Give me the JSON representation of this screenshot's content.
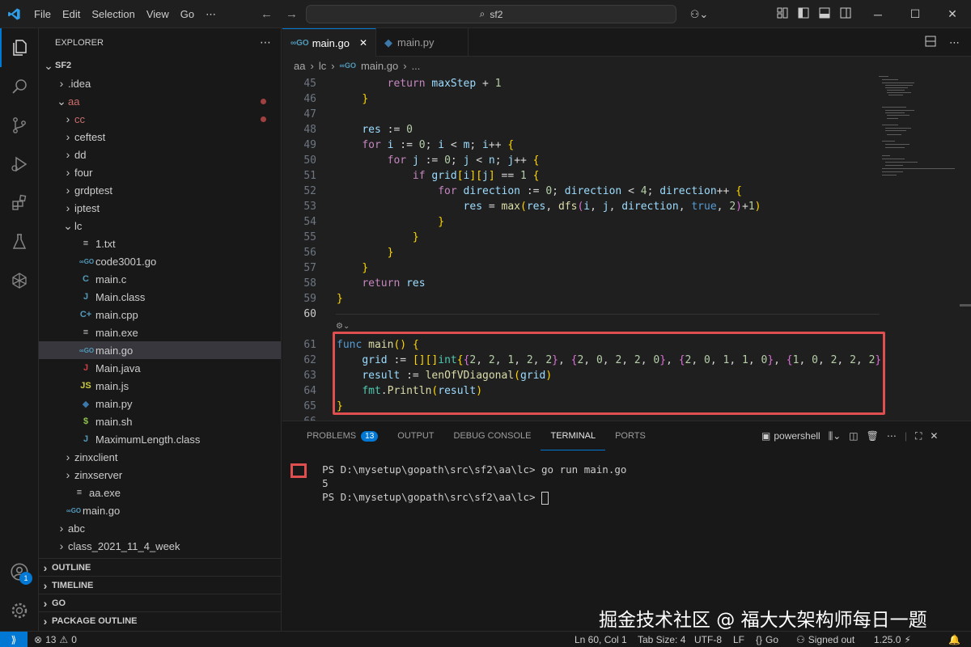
{
  "menu": [
    "File",
    "Edit",
    "Selection",
    "View",
    "Go",
    "⋯"
  ],
  "command_center": "sf2",
  "sidebar": {
    "title": "EXPLORER",
    "tree": [
      {
        "label": "SF2",
        "depth": 0,
        "type": "root",
        "open": true
      },
      {
        "label": ".idea",
        "depth": 1,
        "type": "folder",
        "open": false
      },
      {
        "label": "aa",
        "depth": 1,
        "type": "folder",
        "open": true,
        "modified": true
      },
      {
        "label": "cc",
        "depth": 2,
        "type": "folder",
        "open": false,
        "modified": true
      },
      {
        "label": "ceftest",
        "depth": 2,
        "type": "folder",
        "open": false
      },
      {
        "label": "dd",
        "depth": 2,
        "type": "folder",
        "open": false
      },
      {
        "label": "four",
        "depth": 2,
        "type": "folder",
        "open": false
      },
      {
        "label": "grdptest",
        "depth": 2,
        "type": "folder",
        "open": false
      },
      {
        "label": "iptest",
        "depth": 2,
        "type": "folder",
        "open": false
      },
      {
        "label": "lc",
        "depth": 2,
        "type": "folder",
        "open": true
      },
      {
        "label": "1.txt",
        "depth": 3,
        "type": "txt"
      },
      {
        "label": "code3001.go",
        "depth": 3,
        "type": "go"
      },
      {
        "label": "main.c",
        "depth": 3,
        "type": "c"
      },
      {
        "label": "Main.class",
        "depth": 3,
        "type": "java"
      },
      {
        "label": "main.cpp",
        "depth": 3,
        "type": "cpp"
      },
      {
        "label": "main.exe",
        "depth": 3,
        "type": "txt"
      },
      {
        "label": "main.go",
        "depth": 3,
        "type": "go",
        "selected": true
      },
      {
        "label": "Main.java",
        "depth": 3,
        "type": "javared"
      },
      {
        "label": "main.js",
        "depth": 3,
        "type": "js"
      },
      {
        "label": "main.py",
        "depth": 3,
        "type": "py"
      },
      {
        "label": "main.sh",
        "depth": 3,
        "type": "sh"
      },
      {
        "label": "MaximumLength.class",
        "depth": 3,
        "type": "java"
      },
      {
        "label": "zinxclient",
        "depth": 2,
        "type": "folder",
        "open": false
      },
      {
        "label": "zinxserver",
        "depth": 2,
        "type": "folder",
        "open": false
      },
      {
        "label": "aa.exe",
        "depth": 2,
        "type": "txt"
      },
      {
        "label": "main.go",
        "depth": 1,
        "type": "go"
      },
      {
        "label": "abc",
        "depth": 1,
        "type": "folder",
        "open": false
      },
      {
        "label": "class_2021_11_4_week",
        "depth": 1,
        "type": "folder",
        "open": false
      }
    ],
    "sections": [
      "OUTLINE",
      "TIMELINE",
      "GO",
      "PACKAGE OUTLINE"
    ]
  },
  "tabs": [
    {
      "label": "main.go",
      "active": true
    },
    {
      "label": "main.py",
      "active": false
    }
  ],
  "breadcrumb": [
    "aa",
    "lc",
    "main.go",
    "..."
  ],
  "code_lines": [
    {
      "n": "45",
      "code": "        return maxStep + 1"
    },
    {
      "n": "46",
      "code": "    }"
    },
    {
      "n": "47",
      "code": ""
    },
    {
      "n": "48",
      "code": "    res := 0"
    },
    {
      "n": "49",
      "code": "    for i := 0; i < m; i++ {"
    },
    {
      "n": "50",
      "code": "        for j := 0; j < n; j++ {"
    },
    {
      "n": "51",
      "code": "            if grid[i][j] == 1 {"
    },
    {
      "n": "52",
      "code": "                for direction := 0; direction < 4; direction++ {"
    },
    {
      "n": "53",
      "code": "                    res = max(res, dfs(i, j, direction, true, 2)+1)"
    },
    {
      "n": "54",
      "code": "                }"
    },
    {
      "n": "55",
      "code": "            }"
    },
    {
      "n": "56",
      "code": "        }"
    },
    {
      "n": "57",
      "code": "    }"
    },
    {
      "n": "58",
      "code": "    return res"
    },
    {
      "n": "59",
      "code": "}"
    },
    {
      "n": "60",
      "code": ""
    },
    {
      "n": "61",
      "code": "func main() {"
    },
    {
      "n": "62",
      "code": "    grid := [][]int{{2, 2, 1, 2, 2}, {2, 0, 2, 2, 0}, {2, 0, 1, 1, 0}, {1, 0, 2, 2, 2},"
    },
    {
      "n": "63",
      "code": "    result := lenOfVDiagonal(grid)"
    },
    {
      "n": "64",
      "code": "    fmt.Println(result)"
    },
    {
      "n": "65",
      "code": "}"
    },
    {
      "n": "66",
      "code": ""
    }
  ],
  "panel": {
    "tabs": [
      "PROBLEMS",
      "OUTPUT",
      "DEBUG CONSOLE",
      "TERMINAL",
      "PORTS"
    ],
    "problems_count": "13",
    "shell": "powershell",
    "terminal": [
      "PS D:\\mysetup\\gopath\\src\\sf2\\aa\\lc> go run main.go",
      "5",
      "PS D:\\mysetup\\gopath\\src\\sf2\\aa\\lc> "
    ]
  },
  "watermark": "掘金技术社区 @ 福大大架构师每日一题",
  "status": {
    "problems": "13",
    "warnings": "0",
    "position": "Ln 60, Col 1",
    "tab_size": "Tab Size: 4",
    "encoding": "UTF-8",
    "eol": "LF",
    "language": "Go",
    "signed_out": "Signed out",
    "go_version": "1.25.0"
  },
  "account_badge": "1"
}
